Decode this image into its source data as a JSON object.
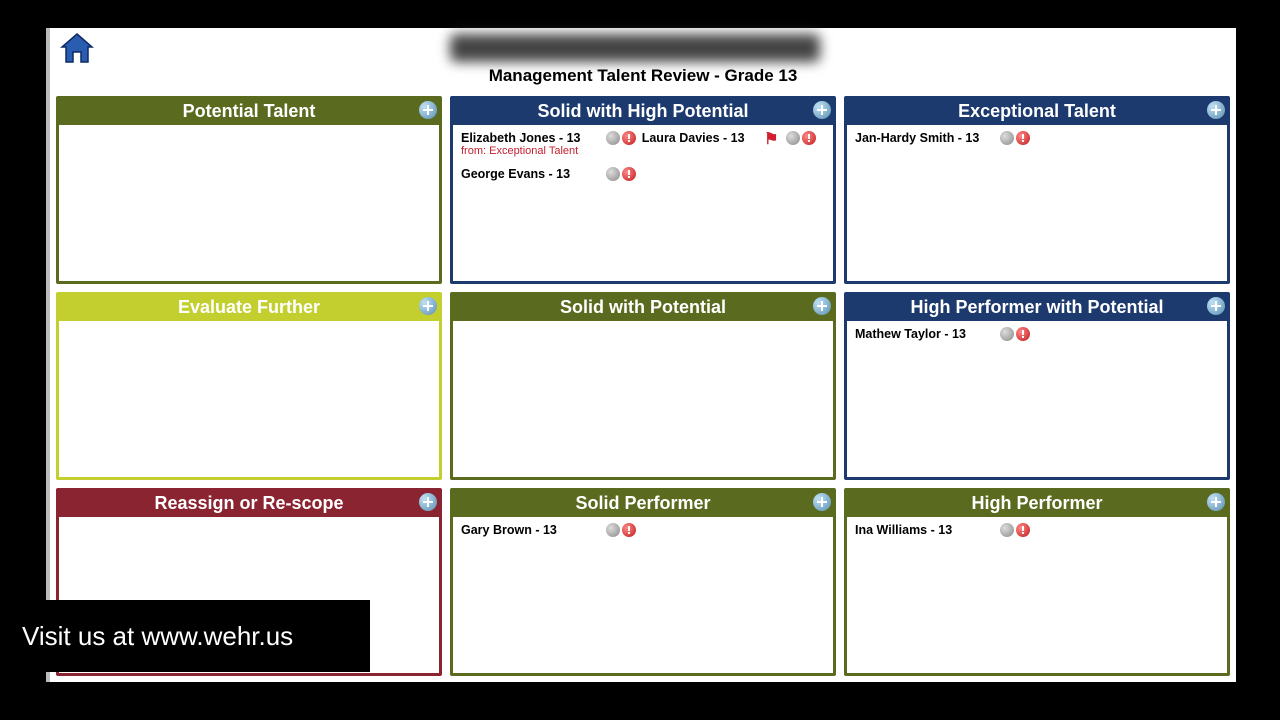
{
  "page_title": "Management Talent Review - Grade 13",
  "caption": "Visit us at www.wehr.us",
  "colors": {
    "olive": "#5a6a1f",
    "navy": "#1c3a6e",
    "lime": "#c2cf2f",
    "maroon": "#8a2430"
  },
  "cells": [
    {
      "id": "potential-talent",
      "title": "Potential Talent",
      "head": "head-olive",
      "border": "border-olive",
      "entries": []
    },
    {
      "id": "solid-high-potential",
      "title": "Solid with High Potential",
      "head": "head-navy",
      "border": "border-navy",
      "entries": [
        {
          "name": "Elizabeth Jones - 13",
          "note": "from: Exceptional Talent"
        },
        {
          "name": "Laura Davies - 13",
          "flag": true
        },
        {
          "name": "George Evans - 13"
        }
      ]
    },
    {
      "id": "exceptional-talent",
      "title": "Exceptional Talent",
      "head": "head-navy",
      "border": "border-navy",
      "entries": [
        {
          "name": "Jan-Hardy Smith - 13"
        }
      ]
    },
    {
      "id": "evaluate-further",
      "title": "Evaluate Further",
      "head": "head-lime",
      "border": "border-lime",
      "entries": []
    },
    {
      "id": "solid-with-potential",
      "title": "Solid with Potential",
      "head": "head-olive",
      "border": "border-olive",
      "entries": []
    },
    {
      "id": "high-performer-potential",
      "title": "High Performer with Potential",
      "head": "head-navy",
      "border": "border-navy",
      "entries": [
        {
          "name": "Mathew Taylor - 13"
        }
      ]
    },
    {
      "id": "reassign-rescope",
      "title": "Reassign or Re-scope",
      "head": "head-maroon",
      "border": "border-maroon",
      "entries": []
    },
    {
      "id": "solid-performer",
      "title": "Solid Performer",
      "head": "head-olive",
      "border": "border-olive",
      "entries": [
        {
          "name": "Gary Brown - 13"
        }
      ]
    },
    {
      "id": "high-performer",
      "title": "High Performer",
      "head": "head-olive",
      "border": "border-olive",
      "entries": [
        {
          "name": "Ina Williams - 13"
        }
      ]
    }
  ]
}
